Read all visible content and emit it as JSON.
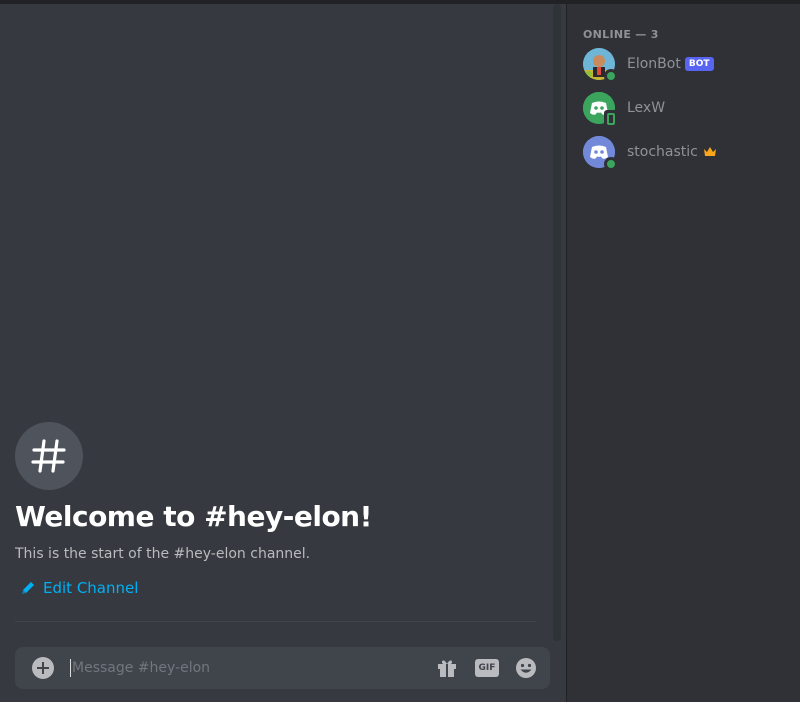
{
  "chat": {
    "welcome_title": "Welcome to #hey-elon!",
    "welcome_subtitle": "This is the start of the #hey-elon channel.",
    "edit_channel_label": "Edit Channel",
    "channel_icon": "hash-icon"
  },
  "composer": {
    "placeholder": "Message #hey-elon",
    "value": "",
    "gif_label": "GIF",
    "icons": [
      "plus-circle-icon",
      "gift-icon",
      "gif-icon",
      "emoji-icon"
    ]
  },
  "members": {
    "header": "ONLINE — 3",
    "list": [
      {
        "name": "ElonBot",
        "tag": "BOT",
        "status": "online"
      },
      {
        "name": "LexW",
        "status": "mobile-online"
      },
      {
        "name": "stochastic",
        "badge": "crown-icon",
        "status": "online"
      }
    ]
  },
  "colors": {
    "chat_bg": "#36393f",
    "sidebar_bg": "#2f3136",
    "link": "#00b0f4",
    "online": "#3ba55d",
    "bot_tag": "#5865f2",
    "crown": "#faa61a"
  }
}
